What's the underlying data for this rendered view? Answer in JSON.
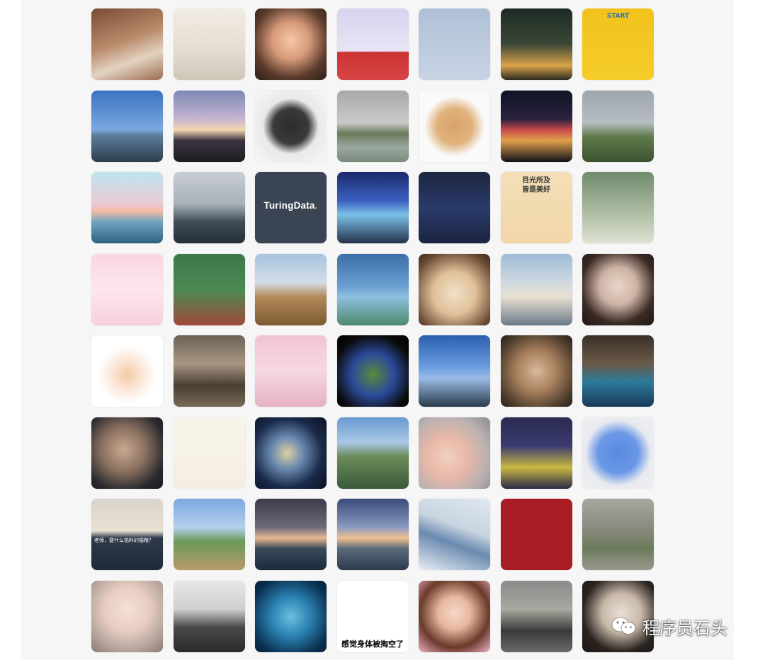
{
  "captions": {
    "start": "START",
    "turing_main": "TuringData",
    "turing_dot": ".",
    "tiger_line1": "目光所及",
    "tiger_line2": "皆是美好",
    "cat_subtitle": "老师，要什么馅料的猫粮？",
    "dog_text": "感觉身体被掏空了"
  },
  "watermark": {
    "icon": "wechat-icon",
    "text": "程序员石头"
  },
  "avatars": [
    {
      "id": "r1c1",
      "subject": "man-in-reeds",
      "bg": "linear-gradient(160deg,#7a4b35 0%,#b98a6a 45%,#e3d3c2 70%,#9c6b4f 100%)"
    },
    {
      "id": "r1c2",
      "subject": "girl-reading-chair",
      "bg": "linear-gradient(180deg,#f1ece4 0%,#e4dcd0 60%,#cfc6b8 100%)"
    },
    {
      "id": "r1c3",
      "subject": "smiling-girl-red-hat",
      "bg": "radial-gradient(circle at 50% 45%,#f4c7a8 0%,#d69a7a 35%,#5a3a2b 70%,#2d1e17 100%)"
    },
    {
      "id": "r1c4",
      "subject": "cartoon-boy-red-scarf",
      "bg": "linear-gradient(180deg,#d9d3ef 0%,#e8e4f4 60%,#c33 61%,#d64545 100%)"
    },
    {
      "id": "r1c5",
      "subject": "anime-swordsman",
      "bg": "linear-gradient(180deg,#aebfd6 0%,#c8d4e4 100%)"
    },
    {
      "id": "r1c6",
      "subject": "city-night-girl",
      "bg": "linear-gradient(180deg,#1c2a24 0%,#3b4736 50%,#d9a24a 80%,#2c2a22 100%)"
    },
    {
      "id": "r1c7",
      "subject": "man-yellow-frame",
      "bg": "linear-gradient(180deg,#f2c21b 0%,#f5cc2a 100%)"
    },
    {
      "id": "r2c1",
      "subject": "lighthouse-sea",
      "bg": "linear-gradient(180deg,#3c73c2 0%,#7aa9e0 55%,#5f7f9c 62%,#2c3d4d 100%)"
    },
    {
      "id": "r2c2",
      "subject": "sunset-clouds",
      "bg": "linear-gradient(180deg,#7d88b5 0%,#c5b5cf 40%,#f5d7b0 55%,#3a3440 70%,#1f1c22 100%)"
    },
    {
      "id": "r2c3",
      "subject": "cat-breaking-wall",
      "bg": "radial-gradient(circle at 50% 50%,#2c2c2c 0%,#3a3a3a 35%,#e9e9e9 55%,#f7f7f7 100%)"
    },
    {
      "id": "r2c4",
      "subject": "foggy-lake-bridge",
      "bg": "linear-gradient(180deg,#a8a8a8 0%,#c9c9c9 45%,#6a7a5a 60%,#9aa8a0 80%,#7a8a7a 100%)"
    },
    {
      "id": "r2c5",
      "subject": "angry-dog-sticker",
      "bg": "radial-gradient(circle at 50% 50%,#d8a36a 0%,#e0b27c 35%,#fafafa 60%,#fafafa 100%)"
    },
    {
      "id": "r2c6",
      "subject": "tower-night-skyline",
      "bg": "linear-gradient(180deg,#0f1424 0%,#2b2240 40%,#c94a4a 55%,#e0a04c 70%,#101018 100%)"
    },
    {
      "id": "r2c7",
      "subject": "green-hill-fog",
      "bg": "linear-gradient(180deg,#9ea6ae 0%,#b6bcc2 45%,#5f7a4a 65%,#3c5230 100%)"
    },
    {
      "id": "r3c1",
      "subject": "whale-tail-sunset",
      "bg": "linear-gradient(180deg,#bfe5ef 0%,#e8c9d3 45%,#f4b9a3 55%,#6fa4c0 70%,#2f5f80 100%)"
    },
    {
      "id": "r3c2",
      "subject": "man-backpack-sea",
      "bg": "linear-gradient(180deg,#c9ced4 0%,#a8b0b8 45%,#3e4c58 70%,#23303a 100%)"
    },
    {
      "id": "r3c3",
      "subject": "turingdata-logo",
      "bg": "#3b4452"
    },
    {
      "id": "r3c4",
      "subject": "car-neon-street",
      "bg": "linear-gradient(180deg,#1a2a6a 0%,#3a5fc0 40%,#7ac0e8 60%,#26324a 100%)"
    },
    {
      "id": "r3c5",
      "subject": "rider-helmet",
      "bg": "linear-gradient(180deg,#1d2740 0%,#2a3a6a 50%,#1b2540 100%)"
    },
    {
      "id": "r3c6",
      "subject": "tigers-stack",
      "bg": "linear-gradient(180deg,#f4dfb8 0%,#f1d6a8 100%)"
    },
    {
      "id": "r3c7",
      "subject": "girl-hanfu-green",
      "bg": "linear-gradient(180deg,#6f8a6c 0%,#a6b69c 50%,#dfe3d2 100%)"
    },
    {
      "id": "r4c1",
      "subject": "bunny-flowers",
      "bg": "linear-gradient(180deg,#f9d6e0 0%,#fde6ec 50%,#f8cfdb 100%)"
    },
    {
      "id": "r4c2",
      "subject": "boy-skateboard-cartoon",
      "bg": "linear-gradient(180deg,#3b7a48 0%,#4b8a55 50%,#a04a38 100%)"
    },
    {
      "id": "r4c3",
      "subject": "girl-grassland",
      "bg": "linear-gradient(180deg,#a7c3df 0%,#d3dde6 40%,#b38a5a 60%,#7d5a32 100%)"
    },
    {
      "id": "r4c4",
      "subject": "girl-sparkle-field",
      "bg": "linear-gradient(180deg,#3c6ea8 0%,#6a9ed0 45%,#8cc0e0 60%,#4e8a6e 100%)"
    },
    {
      "id": "r4c5",
      "subject": "shiba-flower-crown",
      "bg": "radial-gradient(circle at 50% 55%,#f1e1c8 0%,#e0c09a 40%,#6b4a34 80%,#3a2a1f 100%)"
    },
    {
      "id": "r4c6",
      "subject": "two-boys-playing",
      "bg": "linear-gradient(180deg,#9fbcd8 0%,#cfd9e0 40%,#e8e0d0 60%,#6a7a8a 100%)"
    },
    {
      "id": "r4c7",
      "subject": "girl-portrait",
      "bg": "radial-gradient(circle at 50% 45%,#e9d5c8 0%,#cdb3a5 35%,#3a2a24 70%,#1f1614 100%)"
    },
    {
      "id": "r5c1",
      "subject": "cartoon-girl-bun",
      "bg": "radial-gradient(circle at 50% 55%,#f4c9a5 0%,#fbe8da 30%,#ffffff 55%,#ffffff 100%)"
    },
    {
      "id": "r5c2",
      "subject": "snow-cat-fence",
      "bg": "linear-gradient(180deg,#6c6256 0%,#a89684 40%,#4a3e32 70%,#7a6a58 100%)"
    },
    {
      "id": "r5c3",
      "subject": "cartoon-pink-glasses",
      "bg": "linear-gradient(180deg,#f2c5d2 0%,#f6d8e0 50%,#e6b0c0 100%)"
    },
    {
      "id": "r5c4",
      "subject": "soldier-cartoon-green",
      "bg": "radial-gradient(circle at 50% 55%,#5a8a3a 0%,#2b4a9a 40%,#0a0a0a 75%,#000000 100%)"
    },
    {
      "id": "r5c5",
      "subject": "skyscrapers-sky",
      "bg": "linear-gradient(180deg,#2b5fb0 0%,#6b9ee0 45%,#9abce6 60%,#2a3a4a 100%)"
    },
    {
      "id": "r5c6",
      "subject": "girl-close-up",
      "bg": "radial-gradient(circle at 50% 50%,#d9b89a 0%,#a8805e 40%,#4a3a2a 80%,#2a2018 100%)"
    },
    {
      "id": "r5c7",
      "subject": "basketball-player",
      "bg": "linear-gradient(180deg,#3a3028 0%,#6a5a48 40%,#2a7a9a 65%,#1a3a5a 100%)"
    },
    {
      "id": "r6c1",
      "subject": "woman-phone-selfie",
      "bg": "radial-gradient(circle at 45% 45%,#c9a890 0%,#8a7060 40%,#2a2a2e 75%,#1a1a1e 100%)"
    },
    {
      "id": "r6c2",
      "subject": "line-art-couple",
      "bg": "linear-gradient(180deg,#f8f4e8 0%,#f4efe0 100%)"
    },
    {
      "id": "r6c3",
      "subject": "face-shattered-glass",
      "bg": "radial-gradient(circle at 45% 50%,#e0d0a0 0%,#6a8ab0 30%,#1a2a4a 65%,#0a1020 100%)"
    },
    {
      "id": "r6c4",
      "subject": "valley-mountains",
      "bg": "linear-gradient(180deg,#6a9ad0 0%,#aac8e6 35%,#6a8a5a 55%,#3a5a3a 100%)"
    },
    {
      "id": "r6c5",
      "subject": "mother-baby",
      "bg": "radial-gradient(circle at 40% 55%,#f2d0c0 0%,#e8b8a8 35%,#b8b0b0 70%,#8a8890 100%)"
    },
    {
      "id": "r6c6",
      "subject": "girl-cinema-seats",
      "bg": "linear-gradient(180deg,#2a2a50 0%,#3a3a70 40%,#c8b840 70%,#2a2a48 100%)"
    },
    {
      "id": "r6c7",
      "subject": "blue-smiley-pillow",
      "bg": "radial-gradient(circle at 50% 50%,#5a8ae0 0%,#6a98e6 40%,#e8eaf0 65%,#f0f0f2 100%)"
    },
    {
      "id": "r7c1",
      "subject": "cat-subtitle",
      "bg": "linear-gradient(180deg,#d9d4cc 0%,#e8e0d2 45%,#2e3a4a 55%,#1e2a3a 100%)"
    },
    {
      "id": "r7c2",
      "subject": "father-child-path",
      "bg": "linear-gradient(180deg,#7aa8e0 0%,#b6d0ec 40%,#6a9a5a 60%,#b89a6a 100%)"
    },
    {
      "id": "r7c3",
      "subject": "sunset-sea-girl",
      "bg": "linear-gradient(180deg,#3a3a4a 0%,#6a6a7a 40%,#e8b890 55%,#3a4a5a 70%,#1a2a3a 100%)"
    },
    {
      "id": "r7c4",
      "subject": "jumping-beach",
      "bg": "linear-gradient(180deg,#3a4a7a 0%,#8a9ac0 40%,#f0c090 55%,#5a6a7a 70%,#2a3a4a 100%)"
    },
    {
      "id": "r7c5",
      "subject": "skiing-snow",
      "bg": "linear-gradient(200deg,#e0e8f0 0%,#c8d4e0 40%,#6a8ab0 60%,#e8eef4 100%)"
    },
    {
      "id": "r7c6",
      "subject": "red-hammer-logo",
      "bg": "#a81c24"
    },
    {
      "id": "r7c7",
      "subject": "old-wall-windows",
      "bg": "linear-gradient(180deg,#a8a8a0 0%,#8a8a80 40%,#6a7a5a 70%,#9a9a90 100%)"
    },
    {
      "id": "r8c1",
      "subject": "pig-figurines",
      "bg": "radial-gradient(circle at 50% 40%,#f4e0d8 0%,#e8ccc0 40%,#b8a8a0 70%,#8a7a70 100%)"
    },
    {
      "id": "r8c2",
      "subject": "warrior-horse",
      "bg": "linear-gradient(180deg,#e8e8e8 0%,#cfcfcf 40%,#4a4a4a 65%,#2a2a2a 100%)"
    },
    {
      "id": "r8c3",
      "subject": "blue-bokeh",
      "bg": "radial-gradient(circle at 50% 50%,#6ac0e0 0%,#2a80b0 40%,#0a3050 80%,#06203a 100%)"
    },
    {
      "id": "r8c4",
      "subject": "rabbit-meme",
      "bg": "#ffffff"
    },
    {
      "id": "r8c5",
      "subject": "anime-girl-portrait",
      "bg": "radial-gradient(circle at 50% 45%,#f6d8c8 0%,#e8b8a0 30%,#6a3a2a 65%,#f0b0c8 100%)"
    },
    {
      "id": "r8c6",
      "subject": "person-scooters",
      "bg": "linear-gradient(180deg,#8a8a8a 0%,#a8a8a0 40%,#3a3a3a 70%,#6a6a6a 100%)"
    },
    {
      "id": "r8c7",
      "subject": "girl-hair-clip",
      "bg": "radial-gradient(circle at 55% 45%,#e8e0d8 0%,#c8b8a8 35%,#2a2420 70%,#1a1614 100%)"
    }
  ]
}
